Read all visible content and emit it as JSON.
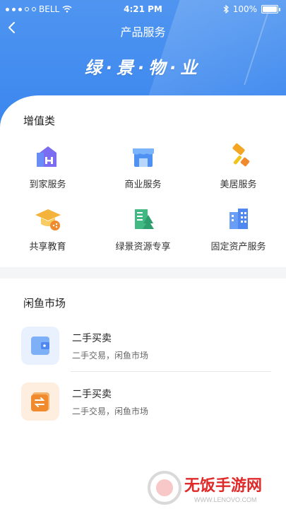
{
  "status": {
    "carrier": "BELL",
    "time": "4:21 PM",
    "battery": "100%"
  },
  "nav": {
    "title": "产品服务"
  },
  "brand": {
    "text": "绿·景·物·业"
  },
  "value_added": {
    "title": "增值类",
    "items": [
      {
        "label": "到家服务",
        "icon": "home-service-icon"
      },
      {
        "label": "商业服务",
        "icon": "store-icon"
      },
      {
        "label": "美居服务",
        "icon": "paint-roller-icon"
      },
      {
        "label": "共享教育",
        "icon": "graduation-cap-icon"
      },
      {
        "label": "绿景资源专享",
        "icon": "resource-building-icon"
      },
      {
        "label": "固定资产服务",
        "icon": "office-building-icon"
      }
    ]
  },
  "market": {
    "title": "闲鱼市场",
    "items": [
      {
        "title": "二手买卖",
        "subtitle": "二手交易，闲鱼市场",
        "icon": "wallet-icon"
      },
      {
        "title": "二手买卖",
        "subtitle": "二手交易，闲鱼市场",
        "icon": "exchange-icon"
      }
    ]
  },
  "watermark": {
    "text": "无饭手游网",
    "sub": "WWW.LENOVO.COM"
  },
  "colors": {
    "primary": "#3a86ef",
    "orange": "#f08a2c",
    "green": "#3cb371"
  }
}
